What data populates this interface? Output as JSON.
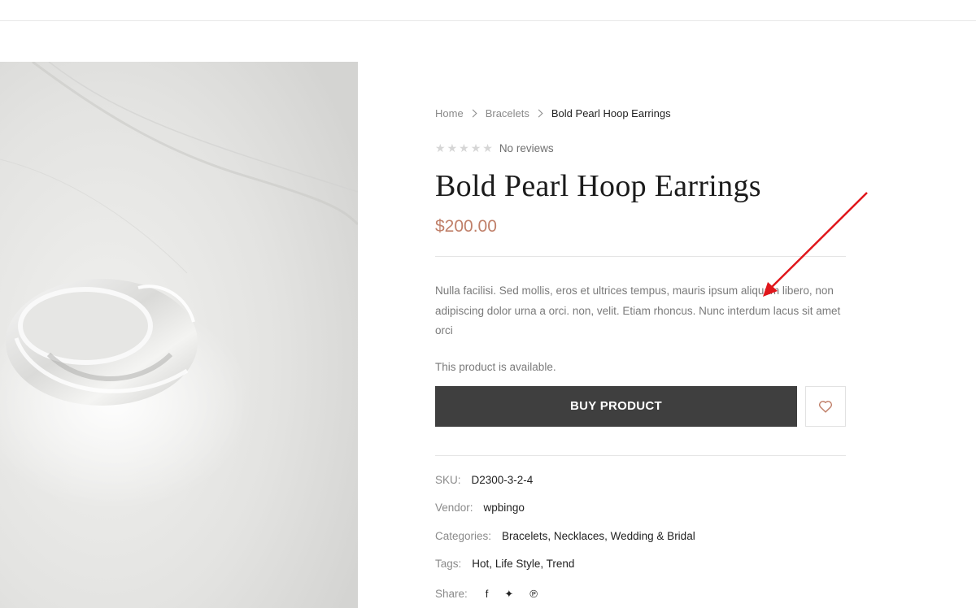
{
  "breadcrumb": {
    "home": "Home",
    "category": "Bracelets",
    "current": "Bold Pearl Hoop Earrings"
  },
  "rating": {
    "stars_filled": 0,
    "stars_total": 5,
    "text": "No reviews"
  },
  "product": {
    "title": "Bold Pearl Hoop Earrings",
    "price": "$200.00",
    "description": "Nulla facilisi. Sed mollis, eros et ultrices tempus, mauris ipsum aliquam libero, non adipiscing dolor urna a orci. non, velit. Etiam rhoncus. Nunc interdum lacus sit amet orci",
    "availability": "This product is available.",
    "buy_label": "BUY PRODUCT"
  },
  "meta": {
    "sku_label": "SKU:",
    "sku_value": "D2300-3-2-4",
    "vendor_label": "Vendor:",
    "vendor_value": "wpbingo",
    "categories_label": "Categories:",
    "categories": [
      "Bracelets",
      "Necklaces",
      "Wedding & Bridal"
    ],
    "tags_label": "Tags:",
    "tags": [
      "Hot",
      "Life Style",
      "Trend"
    ],
    "share_label": "Share:"
  },
  "colors": {
    "price": "#c0806a",
    "button_bg": "#3f3f3f",
    "annotation_arrow": "#e0161b"
  },
  "icons": {
    "breadcrumb_separator": "chevron-right-icon",
    "wishlist": "heart-icon",
    "share": [
      "facebook-icon",
      "twitter-icon",
      "pinterest-icon"
    ]
  }
}
